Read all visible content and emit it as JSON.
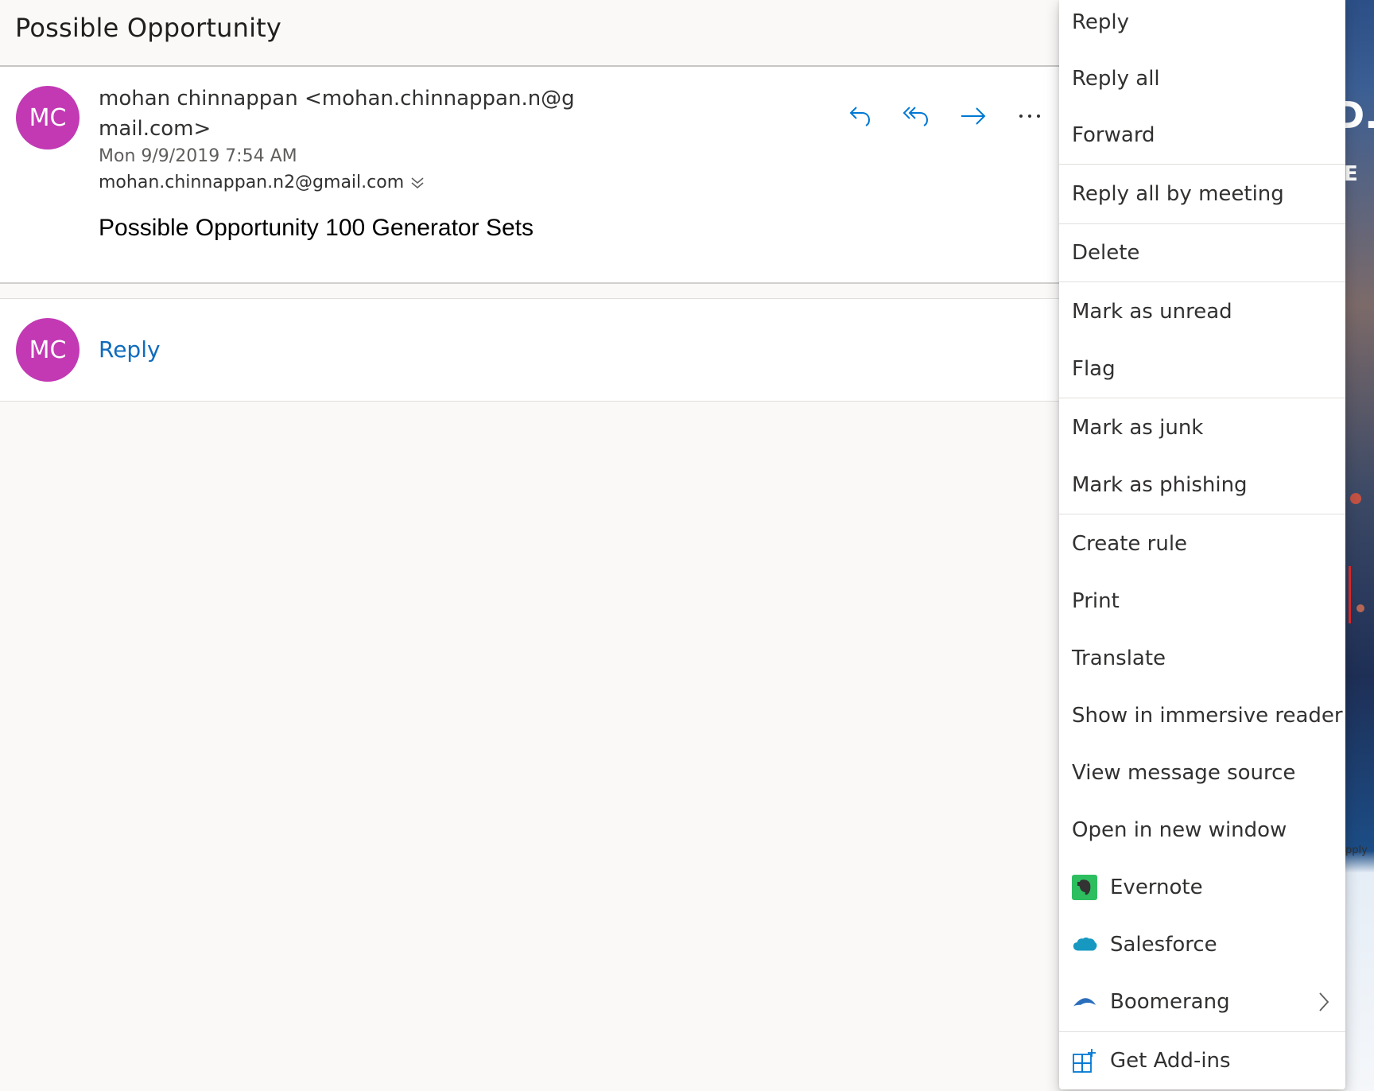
{
  "conversation": {
    "subject": "Possible Opportunity"
  },
  "message": {
    "avatar_initials": "MC",
    "sender": "mohan chinnappan <mohan.chinnappan.n@gmail.com>",
    "date": "Mon 9/9/2019 7:54 AM",
    "recipient": "mohan.chinnappan.n2@gmail.com",
    "body": "Possible Opportunity 100 Generator Sets",
    "actions": {
      "reply_icon": "reply-arrow-icon",
      "reply_all_icon": "reply-all-arrow-icon",
      "forward_icon": "forward-arrow-icon",
      "more_icon": "ellipsis-icon"
    }
  },
  "reply_bar": {
    "avatar_initials": "MC",
    "reply_label": "Reply"
  },
  "background_fragment": {
    "letter_top": "D.",
    "letter_mid": "E",
    "text": "pply"
  },
  "context_menu": {
    "items": [
      {
        "label": "Reply"
      },
      {
        "label": "Reply all"
      },
      {
        "label": "Forward"
      },
      {
        "label": "Reply all by meeting"
      },
      {
        "label": "Delete"
      },
      {
        "label": "Mark as unread"
      },
      {
        "label": "Flag"
      },
      {
        "label": "Mark as junk"
      },
      {
        "label": "Mark as phishing"
      },
      {
        "label": "Create rule"
      },
      {
        "label": "Print"
      },
      {
        "label": "Translate"
      },
      {
        "label": "Show in immersive reader"
      },
      {
        "label": "View message source"
      },
      {
        "label": "Open in new window"
      },
      {
        "label": "Evernote",
        "icon": "evernote-icon"
      },
      {
        "label": "Salesforce",
        "icon": "salesforce-icon"
      },
      {
        "label": "Boomerang",
        "icon": "boomerang-icon"
      },
      {
        "label": "Get Add-ins",
        "icon": "add-ins-grid-icon"
      }
    ]
  },
  "colors": {
    "avatar": "#c239b3",
    "link_blue": "#0f6cbd",
    "icon_blue": "#0078d4",
    "evernote_green": "#2dbe60",
    "salesforce_blue": "#1798c1"
  }
}
